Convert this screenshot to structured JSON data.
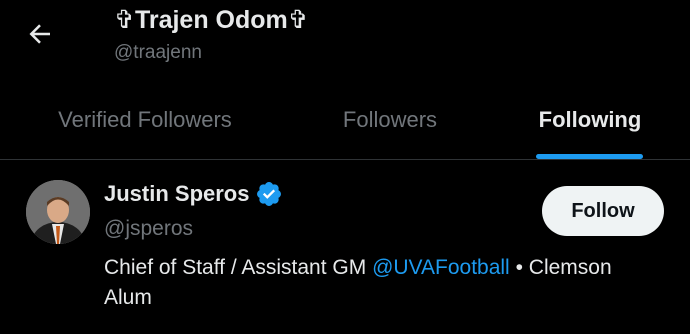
{
  "header": {
    "title": "✞Trajen Odom✞",
    "handle": "@traajenn",
    "back_icon": "arrow-left-icon"
  },
  "tabs": [
    {
      "label": "Verified Followers",
      "active": false
    },
    {
      "label": "Followers",
      "active": false
    },
    {
      "label": "Following",
      "active": true
    }
  ],
  "user": {
    "name": "Justin Speros",
    "handle": "@jsperos",
    "verified_icon": "verified-badge-icon",
    "bio_text": "Chief of Staff / Assistant GM",
    "bio_mention": "@UVAFootball",
    "bio_sep": "•",
    "bio_text2": "Clemson Alum",
    "follow_label": "Follow"
  },
  "colors": {
    "background": "#000000",
    "primary_text": "#e7e9ea",
    "secondary_text": "#71767b",
    "accent": "#1d9bf0",
    "button_bg": "#eff3f4",
    "divider": "#2f3336"
  }
}
